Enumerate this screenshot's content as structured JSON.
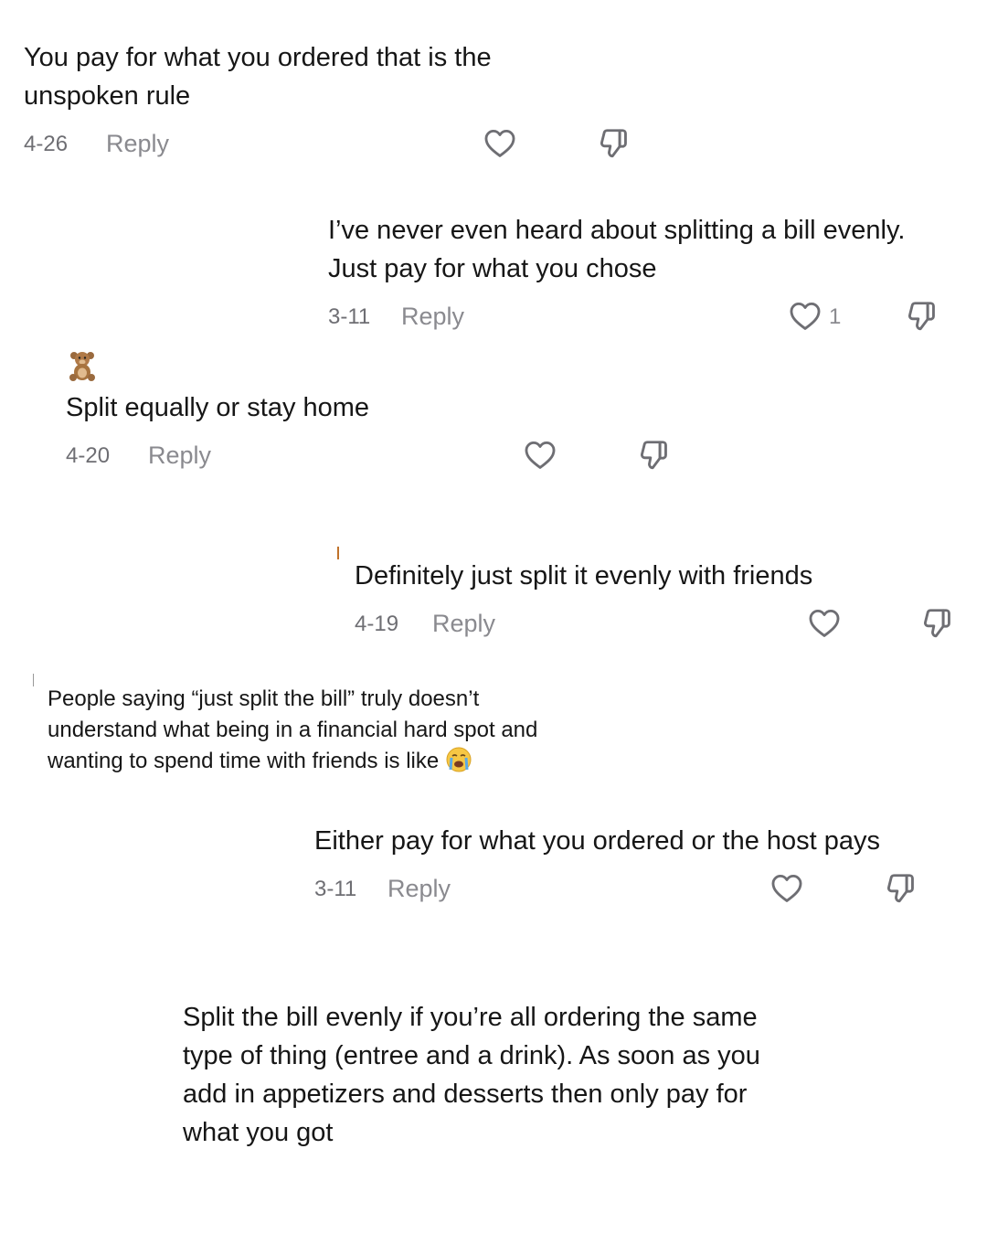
{
  "comments": [
    {
      "text": "You pay for what you ordered that is the unspoken rule",
      "date": "4-26",
      "reply": "Reply"
    },
    {
      "text": "I’ve never even heard about splitting a bill evenly. Just pay for what you chose",
      "date": "3-11",
      "reply": "Reply",
      "likes": "1"
    },
    {
      "text": "Split equally or stay home",
      "date": "4-20",
      "reply": "Reply"
    },
    {
      "text": "Definitely just split it evenly with friends",
      "date": "4-19",
      "reply": "Reply"
    },
    {
      "text": "People saying “just split the bill” truly doesn’t understand what being in a financial hard spot and wanting to spend time with friends is like"
    },
    {
      "text": "Either pay for what you ordered or the host pays",
      "date": "3-11",
      "reply": "Reply"
    },
    {
      "text": "Split the bill evenly if you’re all ordering the same type of thing (entree and a drink). As soon as you add in appetizers and desserts then only pay for what you got"
    }
  ],
  "icons": {
    "like": "heart-outline-icon",
    "dislike": "thumbs-down-icon",
    "teddy": "teddy-bear-emoji",
    "crying": "loudly-crying-emoji"
  },
  "colors": {
    "text": "#161616",
    "meta": "#8a8a8f"
  }
}
